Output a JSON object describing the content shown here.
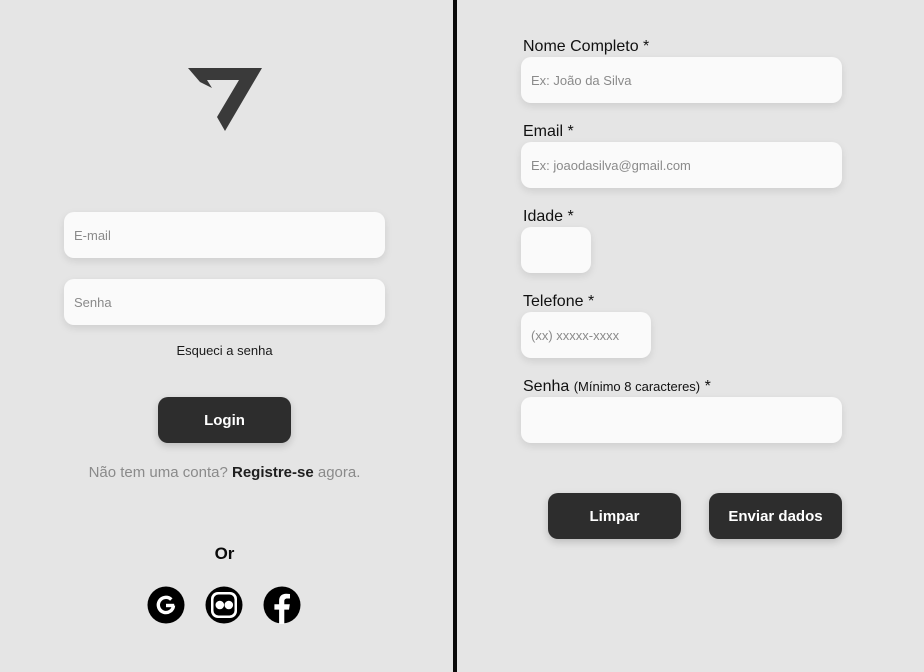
{
  "login": {
    "email_placeholder": "E-mail",
    "password_placeholder": "Senha",
    "forgot_label": "Esqueci a senha",
    "login_label": "Login",
    "register_prefix": "Não tem uma conta?",
    "register_link": "Registre-se",
    "register_suffix": "agora.",
    "or_label": "Or",
    "social": [
      "google-icon",
      "flickr-icon",
      "facebook-icon"
    ]
  },
  "register": {
    "nome_label": "Nome Completo *",
    "nome_placeholder": "Ex: João da Silva",
    "email_label": "Email *",
    "email_placeholder": "Ex: joaodasilva@gmail.com",
    "idade_label": "Idade *",
    "telefone_label": "Telefone *",
    "telefone_placeholder": "(xx) xxxxx-xxxx",
    "senha_label": "Senha",
    "senha_hint": "(Mínimo 8 caracteres)",
    "senha_required": "*",
    "limpar_label": "Limpar",
    "enviar_label": "Enviar dados"
  },
  "colors": {
    "background": "#e5e5e5",
    "divider": "#0a0a0a",
    "button": "#2d2d2d",
    "input": "#fafafa",
    "logo": "#3a3a3a"
  }
}
